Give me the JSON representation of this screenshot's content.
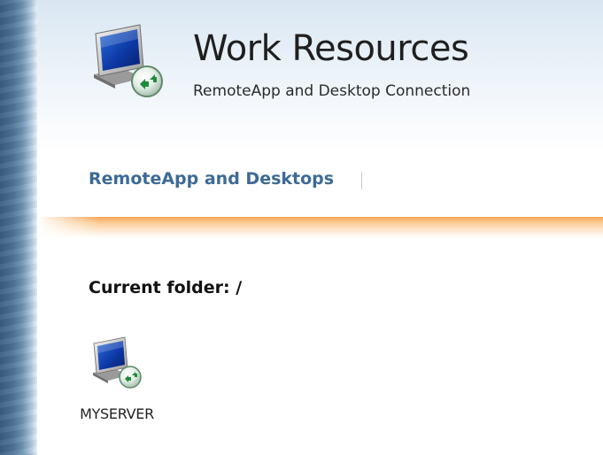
{
  "header": {
    "title": "Work Resources",
    "subtitle": "RemoteApp and Desktop Connection",
    "icon": "remote-desktop-monitor-icon"
  },
  "nav": {
    "tabs": [
      {
        "label": "RemoteApp and Desktops",
        "active": true
      }
    ],
    "separator": "|"
  },
  "folder": {
    "label": "Current folder: /"
  },
  "items": [
    {
      "label": "MYSERVER",
      "icon": "remote-desktop-monitor-icon"
    }
  ],
  "colors": {
    "nav_link": "#3d6a96",
    "accent_orange": "#f6a352",
    "header_blue": "#d8e6f2"
  }
}
